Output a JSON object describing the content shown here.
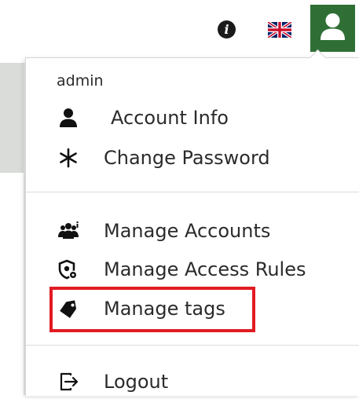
{
  "topbar": {
    "info_icon": "info-icon",
    "language_icon": "uk-flag-icon",
    "user_icon": "user-icon",
    "accent_color": "#2f6f36"
  },
  "dropdown": {
    "username": "admin",
    "items": [
      {
        "label": "Account Info",
        "icon": "user-icon"
      },
      {
        "label": "Change Password",
        "icon": "asterisk-icon"
      },
      {
        "label": "Manage Accounts",
        "icon": "users-icon"
      },
      {
        "label": "Manage Access Rules",
        "icon": "shield-gear-icon"
      },
      {
        "label": "Manage tags",
        "icon": "tag-icon"
      },
      {
        "label": "Logout",
        "icon": "logout-icon"
      }
    ],
    "highlight_color": "#e21b23"
  }
}
